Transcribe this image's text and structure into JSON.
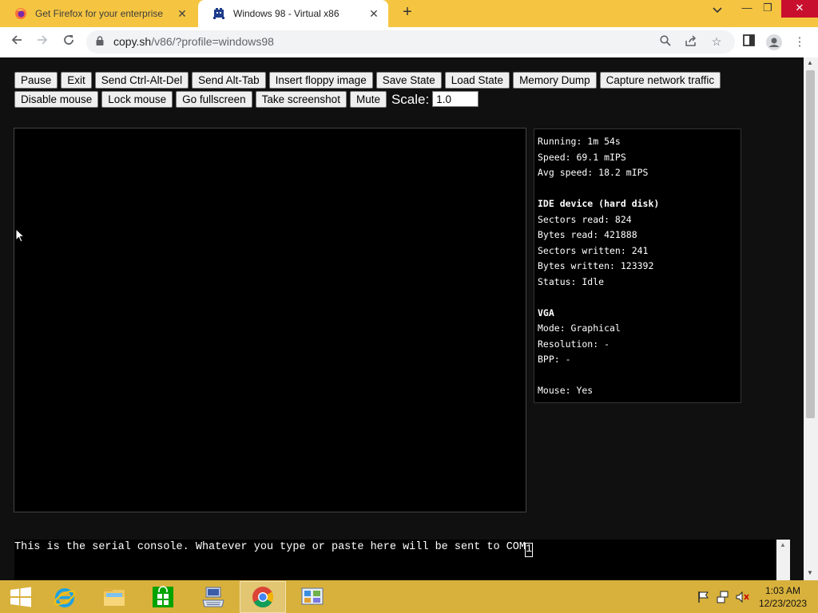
{
  "browser": {
    "tabs": [
      {
        "title": "Get Firefox for your enterprise w",
        "icon": "firefox-icon",
        "active": false
      },
      {
        "title": "Windows 98 - Virtual x86",
        "icon": "v86-icon",
        "active": true
      }
    ],
    "new_tab_label": "+",
    "url": {
      "host": "copy.sh",
      "path": "/v86/?profile=windows98"
    },
    "accent_color": "#f5c542"
  },
  "controls": {
    "buttons": [
      "Pause",
      "Exit",
      "Send Ctrl-Alt-Del",
      "Send Alt-Tab",
      "Insert floppy image",
      "Save State",
      "Load State",
      "Memory Dump",
      "Capture network traffic",
      "Disable mouse",
      "Lock mouse",
      "Go fullscreen",
      "Take screenshot",
      "Mute"
    ],
    "scale_label": "Scale:",
    "scale_value": "1.0"
  },
  "stats": {
    "running": "Running: 1m 54s",
    "speed": "Speed: 69.1 mIPS",
    "avg_speed": "Avg speed: 18.2 mIPS",
    "ide_header": "IDE device (hard disk)",
    "sectors_read": "Sectors read: 824",
    "bytes_read": "Bytes read: 421888",
    "sectors_written": "Sectors written: 241",
    "bytes_written": "Bytes written: 123392",
    "status": "Status: Idle",
    "vga_header": "VGA",
    "mode": "Mode: Graphical",
    "resolution": "Resolution: -",
    "bpp": "BPP: -",
    "mouse": "Mouse: Yes"
  },
  "serial": {
    "text": "This is the serial console. Whatever you type or paste here will be sent to COM",
    "last_char": "1"
  },
  "taskbar": {
    "items": [
      "start-icon",
      "internet-explorer-icon",
      "file-explorer-icon",
      "store-icon",
      "keyboard-app-icon",
      "chrome-icon",
      "control-panel-icon"
    ],
    "time": "1:03 AM",
    "date": "12/23/2023"
  }
}
